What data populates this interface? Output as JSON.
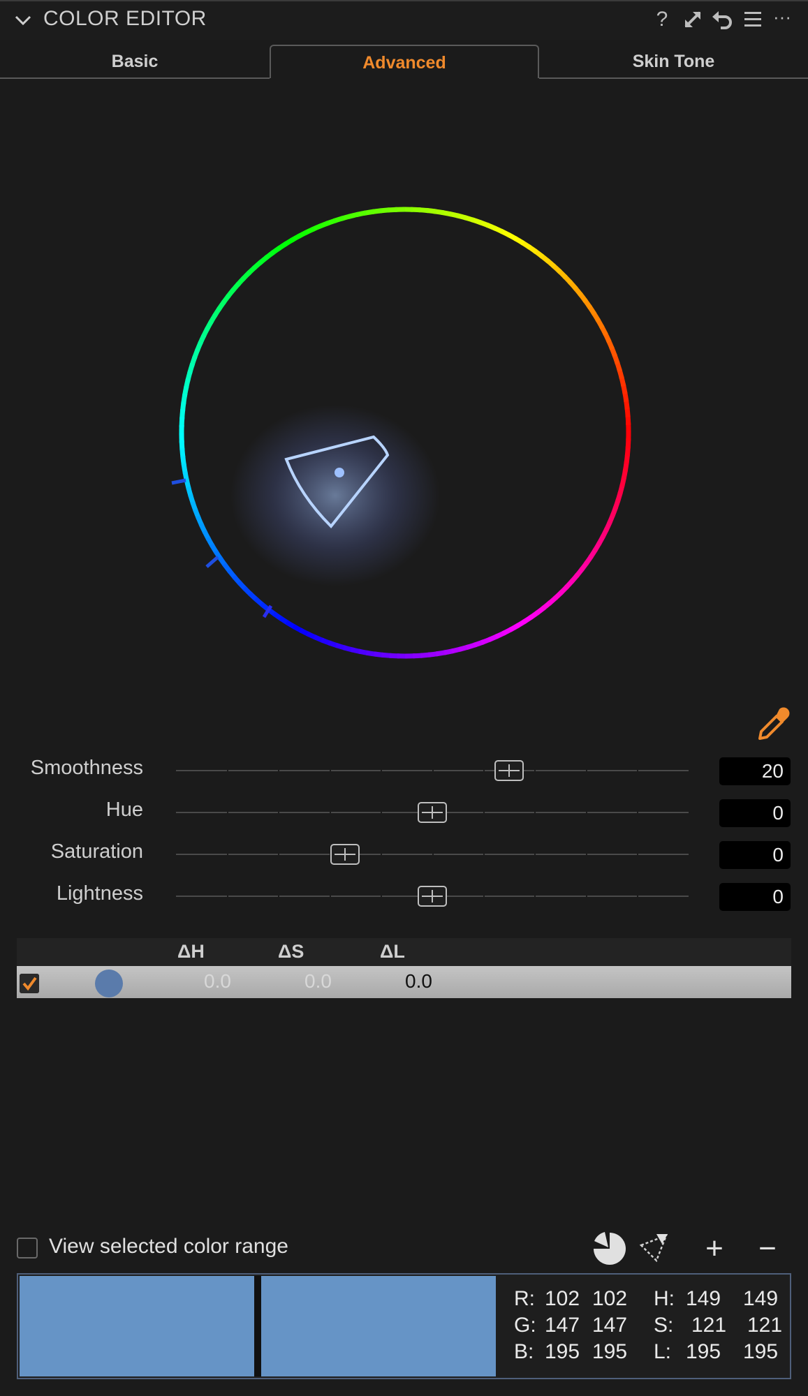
{
  "header": {
    "title": "COLOR EDITOR",
    "icons": [
      "help-icon",
      "expand-icon",
      "reset-icon",
      "presets-icon",
      "more-icon"
    ],
    "help_glyph": "?",
    "more_glyph": "···"
  },
  "tabs": [
    {
      "label": "Basic",
      "active": false
    },
    {
      "label": "Advanced",
      "active": true
    },
    {
      "label": "Skin Tone",
      "active": false
    }
  ],
  "colors": {
    "accent": "#f08a2c",
    "background": "#1b1b1b",
    "selected_color": "#6694c6"
  },
  "sliders": [
    {
      "label": "Smoothness",
      "value": "20",
      "level": 0.65
    },
    {
      "label": "Hue",
      "value": "0",
      "level": 0.5
    },
    {
      "label": "Saturation",
      "value": "0",
      "level": 0.33
    },
    {
      "label": "Lightness",
      "value": "0",
      "level": 0.5
    }
  ],
  "table": {
    "headers": [
      "ΔH",
      "ΔS",
      "ΔL"
    ],
    "rows": [
      {
        "checked": true,
        "swatch_color": "#5a7bab",
        "dh": "0.0",
        "ds": "0.0",
        "dl": "0.0"
      }
    ]
  },
  "view_range": {
    "label": "View selected color range",
    "checked": false
  },
  "bottom_tools": {
    "add_glyph": "+",
    "remove_glyph": "−"
  },
  "readout": {
    "r_label": "R:",
    "g_label": "G:",
    "b_label": "B:",
    "h_label": "H:",
    "s_label": "S:",
    "l_label": "L:",
    "r": [
      "102",
      "102"
    ],
    "g": [
      "147",
      "147"
    ],
    "b": [
      "195",
      "195"
    ],
    "h": [
      "149",
      "149"
    ],
    "s": [
      "121",
      "121"
    ],
    "l": [
      "195",
      "195"
    ]
  }
}
